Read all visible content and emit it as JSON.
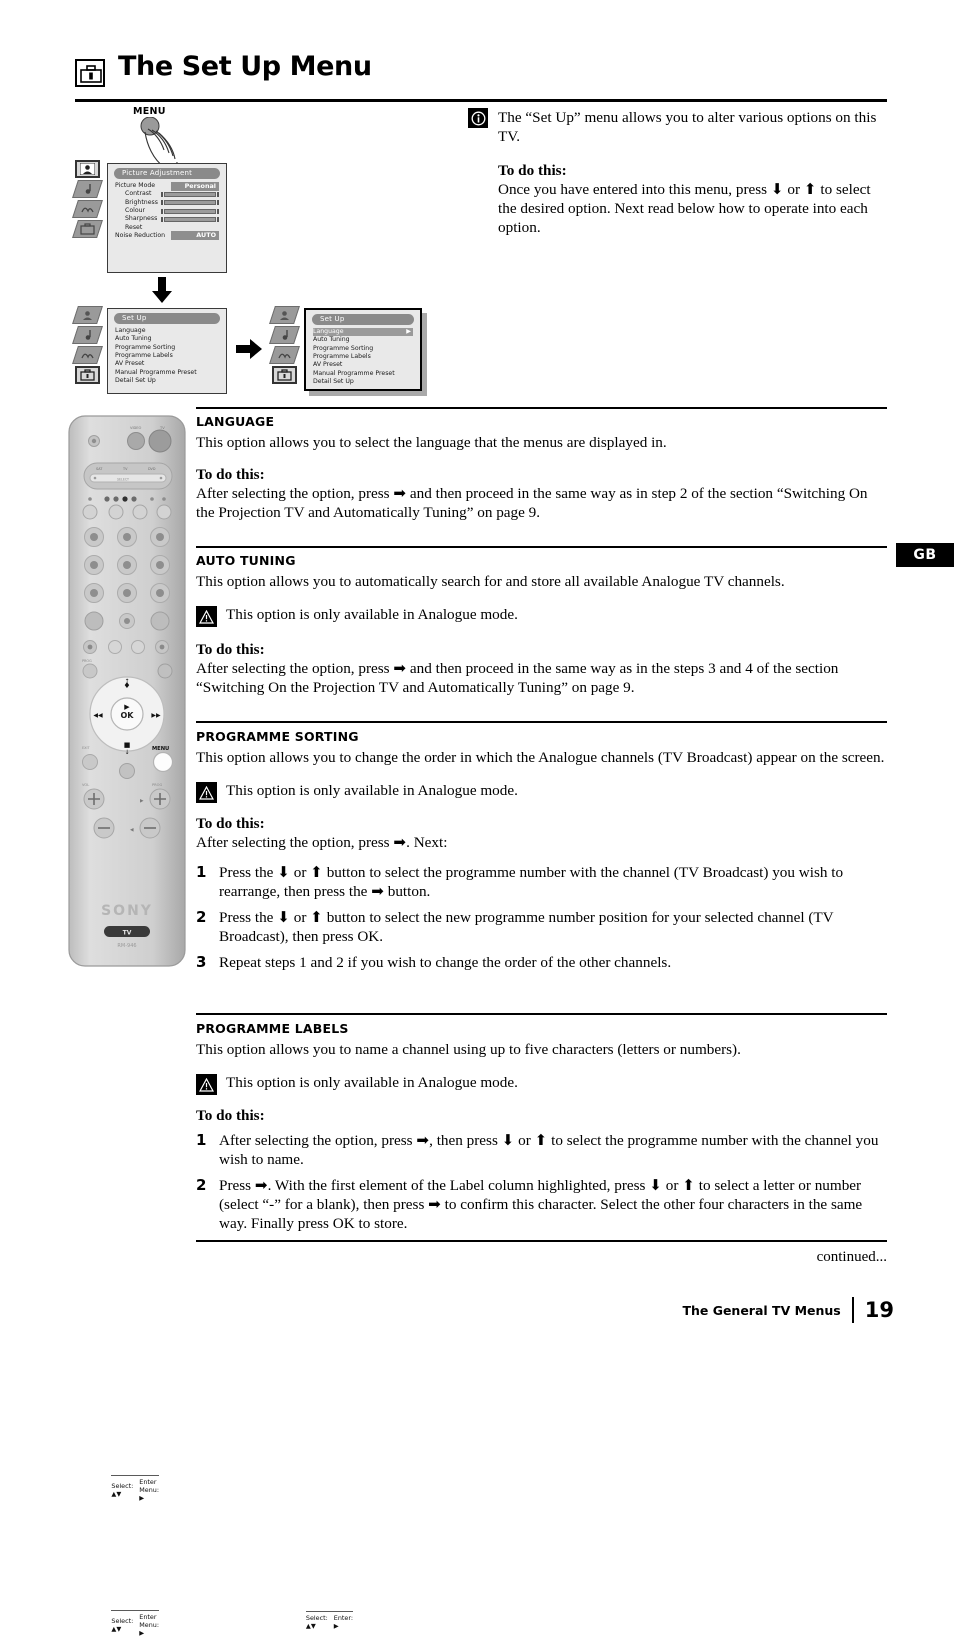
{
  "page": {
    "title": "The Set Up Menu",
    "title_icon": "toolbox-icon",
    "footer_section": "The General TV Menus",
    "page_number": "19",
    "continued": "continued...",
    "side_tab": "GB"
  },
  "diagram": {
    "menu_button_label": "MENU",
    "picture_menu": {
      "title": "Picture Adjustment",
      "rows": [
        {
          "name": "Picture Mode",
          "value": "Personal",
          "type": "value"
        },
        {
          "name": "Contrast",
          "type": "slider",
          "indent": true
        },
        {
          "name": "Brightness",
          "type": "slider",
          "indent": true
        },
        {
          "name": "Colour",
          "type": "slider",
          "indent": true
        },
        {
          "name": "Sharpness",
          "type": "slider",
          "indent": true
        },
        {
          "name": "Reset",
          "type": "plain",
          "indent": true
        },
        {
          "name": "Noise Reduction",
          "value": "AUTO",
          "type": "value"
        }
      ],
      "footer_select": "Select: ▲▼",
      "footer_enter": "Enter Menu: ▶"
    },
    "setup_menu_1": {
      "title": "Set Up",
      "items": [
        "Language",
        "Auto Tuning",
        "Programme Sorting",
        "Programme Labels",
        "AV Preset",
        "Manual Programme Preset",
        "Detail Set Up"
      ],
      "footer_select": "Select: ▲▼",
      "footer_enter": "Enter Menu: ▶"
    },
    "setup_menu_2": {
      "title": "Set Up",
      "items": [
        "Language",
        "Auto Tuning",
        "Programme Sorting",
        "Programme Labels",
        "AV Preset",
        "Manual Programme Preset",
        "Detail Set Up"
      ],
      "highlighted": "Language",
      "footer_select": "Select: ▲▼",
      "footer_enter": "Enter: ▶"
    }
  },
  "intro": {
    "icon": "info-icon",
    "paragraph": "The “Set Up” menu allows you to alter various options on this TV.",
    "todo_heading": "To do this:",
    "todo_text": "Once you have entered into this menu, press ⬇ or ⬆ to select the desired option. Next read below how to operate into each option."
  },
  "sections": {
    "language": {
      "heading": "LANGUAGE",
      "description": "This option allows you to select the language that the menus are displayed in.",
      "todo_heading": "To do this:",
      "todo_text": "After selecting the option, press ➡ and then proceed in the same way as in step 2 of the section “Switching On the Projection TV and Automatically Tuning” on page 9."
    },
    "auto_tuning": {
      "heading": "AUTO TUNING",
      "description": "This option allows you to automatically search for and store all available Analogue TV channels.",
      "warning": "This option is only available in Analogue mode.",
      "todo_heading": "To do this:",
      "todo_text": "After selecting the option, press ➡ and then proceed in the same way as in the steps 3 and 4 of the section “Switching On the Projection TV and Automatically Tuning” on page 9."
    },
    "programme_sorting": {
      "heading": "PROGRAMME SORTING",
      "description": "This option allows you to change the order in which the Analogue channels (TV Broadcast) appear on the screen.",
      "warning": "This option is only available in Analogue mode.",
      "todo_heading": "To do this:",
      "todo_text": "After selecting the option, press ➡. Next:",
      "steps": [
        {
          "num": "1",
          "text": "Press the ⬇ or ⬆ button to select the programme number with the channel (TV Broadcast) you wish to rearrange, then press the ➡ button."
        },
        {
          "num": "2",
          "text": "Press the ⬇ or ⬆ button to select the new programme number position for your selected channel (TV Broadcast), then press OK."
        },
        {
          "num": "3",
          "text": "Repeat steps 1 and 2 if you wish to change the order of the other channels."
        }
      ]
    },
    "programme_labels": {
      "heading": "PROGRAMME LABELS",
      "description": "This option allows you to name a channel using up to five characters (letters or numbers).",
      "warning": "This option is only available in Analogue mode.",
      "todo_heading": "To do this:",
      "steps": [
        {
          "num": "1",
          "text": "After selecting the option, press ➡, then press ⬇ or ⬆ to select the programme number with the channel you wish to name."
        },
        {
          "num": "2",
          "text": "Press ➡. With the first element of the Label column highlighted, press ⬇ or ⬆ to select a letter or number (select “-” for a blank), then press ➡ to confirm this character. Select the other four characters in the same way. Finally press OK to store."
        }
      ]
    }
  },
  "remote": {
    "brand": "SONY",
    "tv_button": "TV",
    "ok_button": "OK",
    "menu_button": "MENU",
    "vol_label": "VOL",
    "prog_label": "PROG"
  },
  "colors": {
    "ink": "#000000",
    "osd_background": "#e9e9e9",
    "osd_title": "#8a8a8a",
    "osd_value": "#8e8e8e",
    "remote_body": "#c9c9c9"
  }
}
